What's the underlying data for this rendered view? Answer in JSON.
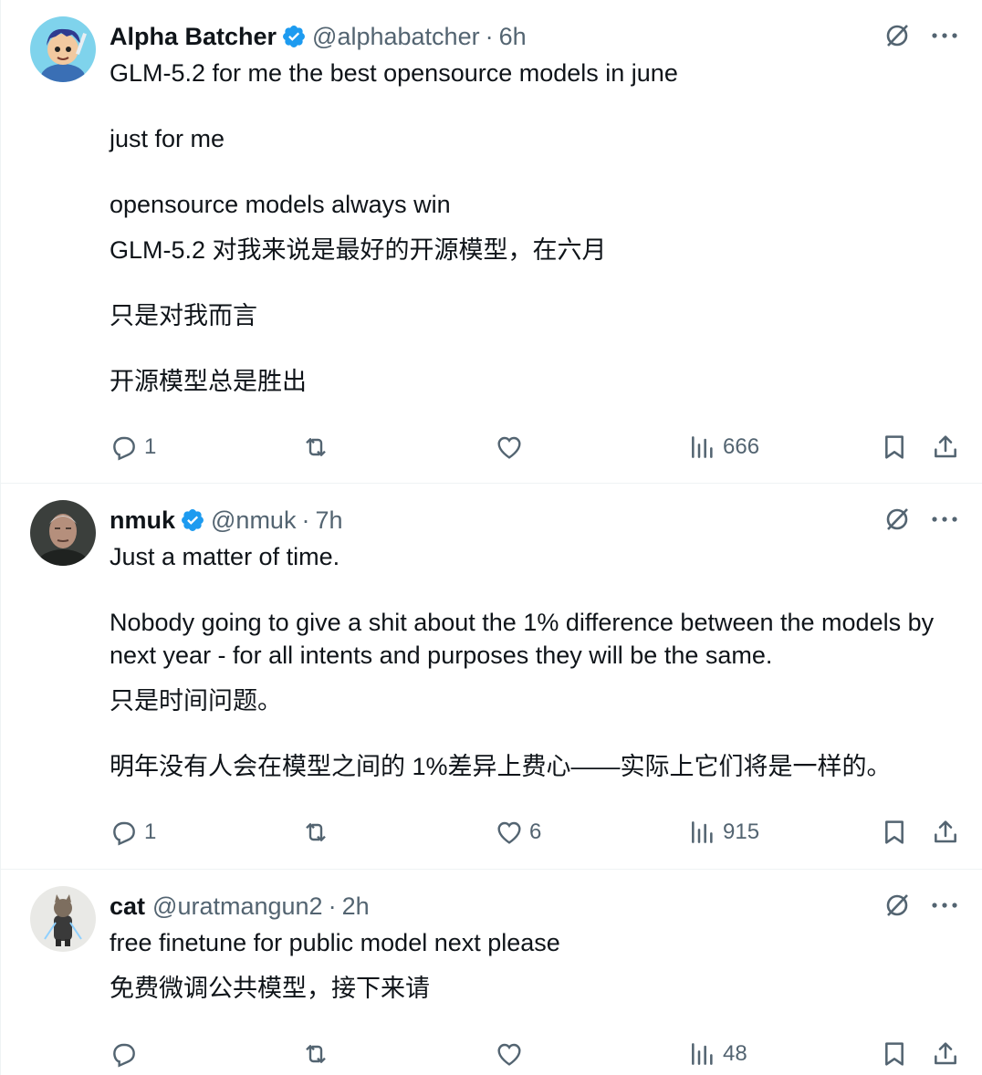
{
  "colors": {
    "text": "#0f1419",
    "muted": "#536471",
    "verified": "#1d9bf0",
    "divider": "#eff3f4"
  },
  "icons": {
    "reply": "reply-icon",
    "retweet": "retweet-icon",
    "like": "heart-icon",
    "views": "views-icon",
    "bookmark": "bookmark-icon",
    "share": "share-icon",
    "grok": "grok-icon",
    "more": "more-icon"
  },
  "tweets": [
    {
      "name": "Alpha Batcher",
      "verified": true,
      "handle": "@alphabatcher",
      "separator": "·",
      "time": "6h",
      "lines": [
        "GLM-5.2 for me the best opensource models in june",
        "just for me",
        "opensource models always win",
        "GLM-5.2 对我来说是最好的开源模型，在六月",
        "只是对我而言",
        "开源模型总是胜出"
      ],
      "replies": "1",
      "reposts": "",
      "likes": "",
      "views": "666"
    },
    {
      "name": "nmuk",
      "verified": true,
      "handle": "@nmuk",
      "separator": "·",
      "time": "7h",
      "lines": [
        "Just a matter of time.",
        "Nobody going to give a shit about the 1% difference between the models by",
        "next year - for all intents and purposes they will be the same.",
        "只是时间问题。",
        "明年没有人会在模型之间的 1%差异上费心——实际上它们将是一样的。"
      ],
      "replies": "1",
      "reposts": "",
      "likes": "6",
      "views": "915"
    },
    {
      "name": "cat",
      "verified": false,
      "handle": "@uratmangun2",
      "separator": "·",
      "time": "2h",
      "lines": [
        "free finetune for public model next please",
        "免费微调公共模型，接下来请"
      ],
      "replies": "",
      "reposts": "",
      "likes": "",
      "views": "48"
    }
  ]
}
